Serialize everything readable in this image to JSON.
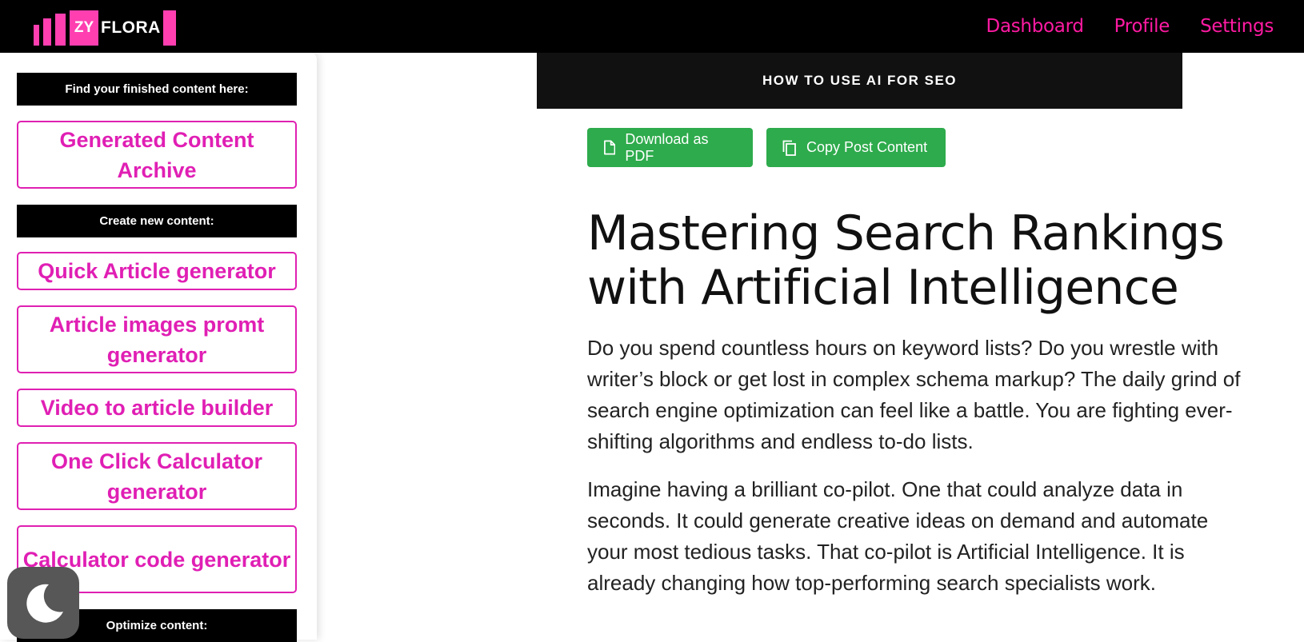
{
  "logo": {
    "zy": "ZY",
    "flora": "FLORA"
  },
  "nav": {
    "dashboard": "Dashboard",
    "profile": "Profile",
    "settings": "Settings"
  },
  "sidebar": {
    "finished_header": "Find your finished content here:",
    "archive": "Generated Content Archive",
    "create_header": "Create new content:",
    "quick_article": "Quick Article generator",
    "article_images": "Article images promt generator",
    "video_to_article": "Video to article builder",
    "calculator_generator": "One Click Calculator generator",
    "calculator_code": "Calculator code generator",
    "optimize_header": "Optimize content:"
  },
  "post": {
    "title_bar": "HOW TO USE AI FOR SEO",
    "download_pdf": "Download as PDF",
    "copy_post": "Copy Post Content",
    "headline": "Mastering Search Rankings with Artificial Intelligence",
    "paragraph1": "Do you spend countless hours on keyword lists? Do you wrestle with writer’s block or get lost in complex schema markup? The daily grind of search engine optimization can feel like a battle. You are fighting ever-shifting algorithms and endless to-do lists.",
    "paragraph2": "Imagine having a brilliant co-pilot. One that could analyze data in seconds. It could generate creative ideas on demand and automate your most tedious tasks. That co-pilot is Artificial Intelligence. It is already changing how top-performing search specialists work."
  },
  "colors": {
    "brand_pink": "#ff1aa3",
    "button_green": "#2eab4c",
    "header_black": "#000000"
  },
  "icons": {
    "dark_mode": "moon-icon",
    "pdf": "file-icon",
    "copy": "copy-icon"
  }
}
